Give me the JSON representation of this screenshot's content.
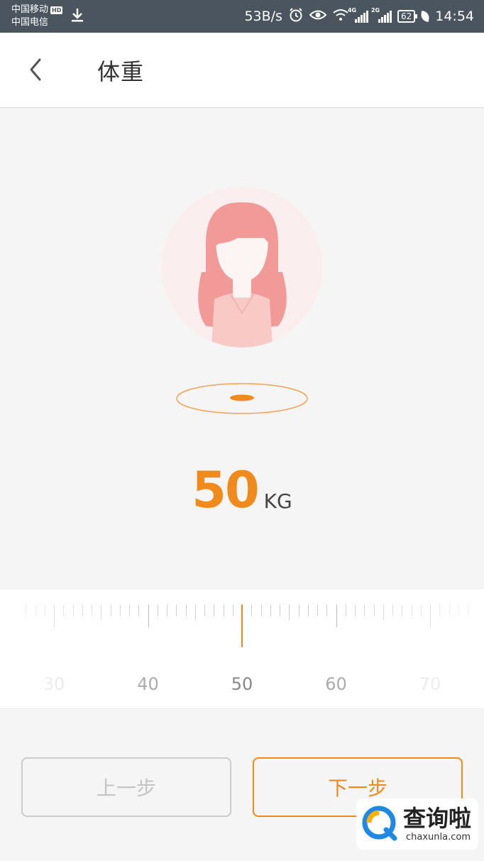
{
  "status_bar": {
    "carrier_1": "中国移动",
    "carrier_1_badge": "HD",
    "carrier_2": "中国电信",
    "download_icon": "download-icon",
    "net_speed": "53B/s",
    "sim1_network": "4G",
    "sim2_network": "2G",
    "battery": "62",
    "time": "14:54"
  },
  "header": {
    "back_icon": "chevron-left-icon",
    "title": "体重"
  },
  "avatar": {
    "icon": "female-avatar-icon"
  },
  "weight": {
    "value": "50",
    "unit": "KG"
  },
  "ruler": {
    "labels": [
      "30",
      "40",
      "50",
      "60",
      "70"
    ],
    "selected": 50,
    "min_visible": 30,
    "max_visible": 70
  },
  "buttons": {
    "prev_label": "上一步",
    "next_label": "下一步"
  },
  "watermark": {
    "cn": "查询啦",
    "en": "chaxunla.com"
  },
  "colors": {
    "accent": "#f08a1c",
    "status_bar": "#4a5560",
    "background": "#f5f5f5",
    "avatar_pink": "#f19a97"
  }
}
